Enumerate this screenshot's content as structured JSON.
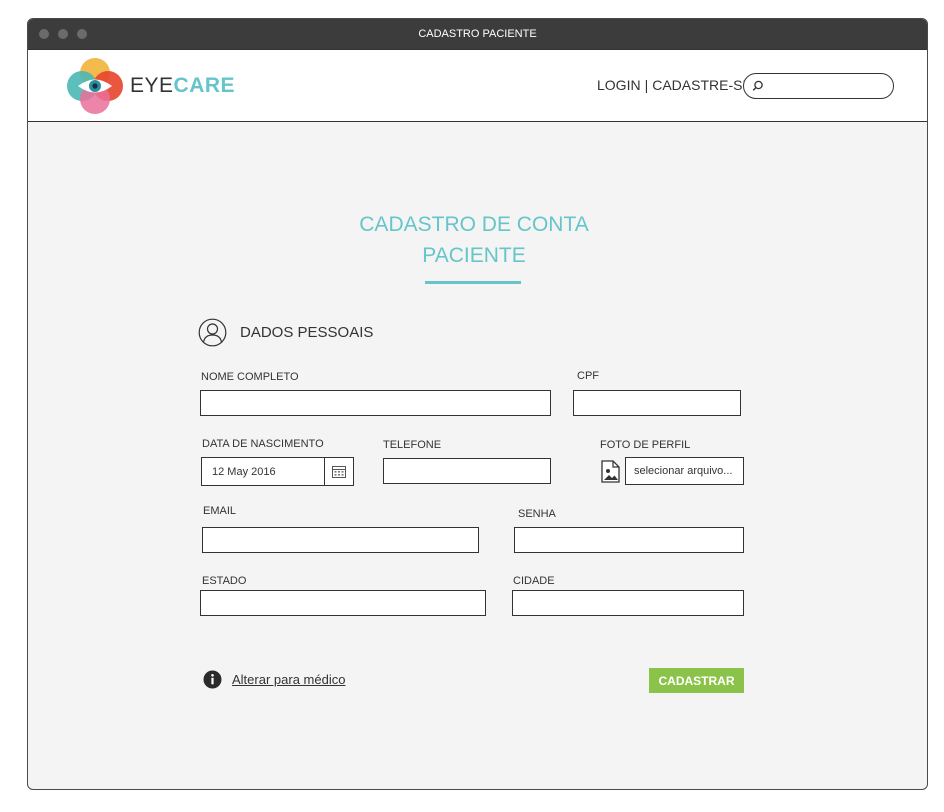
{
  "window": {
    "title": "CADASTRO PACIENTE"
  },
  "header": {
    "logo": {
      "eye": "EYE",
      "care": "CARE"
    },
    "login_label": "LOGIN",
    "separator": "|",
    "signup_label": "CADASTRE-SE",
    "search": {
      "placeholder": "",
      "value": ""
    }
  },
  "form": {
    "title": "CADASTRO DE CONTA\nPACIENTE",
    "section_title": "DADOS PESSOAIS",
    "labels": {
      "full_name": "NOME COMPLETO",
      "cpf": "CPF",
      "birth_date": "DATA  DE NASCIMENTO",
      "phone": "TELEFONE",
      "photo": "FOTO  DE PERFIL",
      "email": "EMAIL",
      "password": "SENHA",
      "state": "ESTADO",
      "city": "CIDADE"
    },
    "values": {
      "full_name": "",
      "cpf": "",
      "birth_date": "12 May 2016",
      "phone": "",
      "photo": "selecionar arquivo...",
      "email": "",
      "password": "",
      "state": "",
      "city": ""
    },
    "switch_link": "Alterar para médico",
    "submit_label": "CADASTRAR"
  },
  "colors": {
    "accent": "#66c5c8",
    "submit": "#8bc34a",
    "titlebar": "#3c3c3c"
  }
}
